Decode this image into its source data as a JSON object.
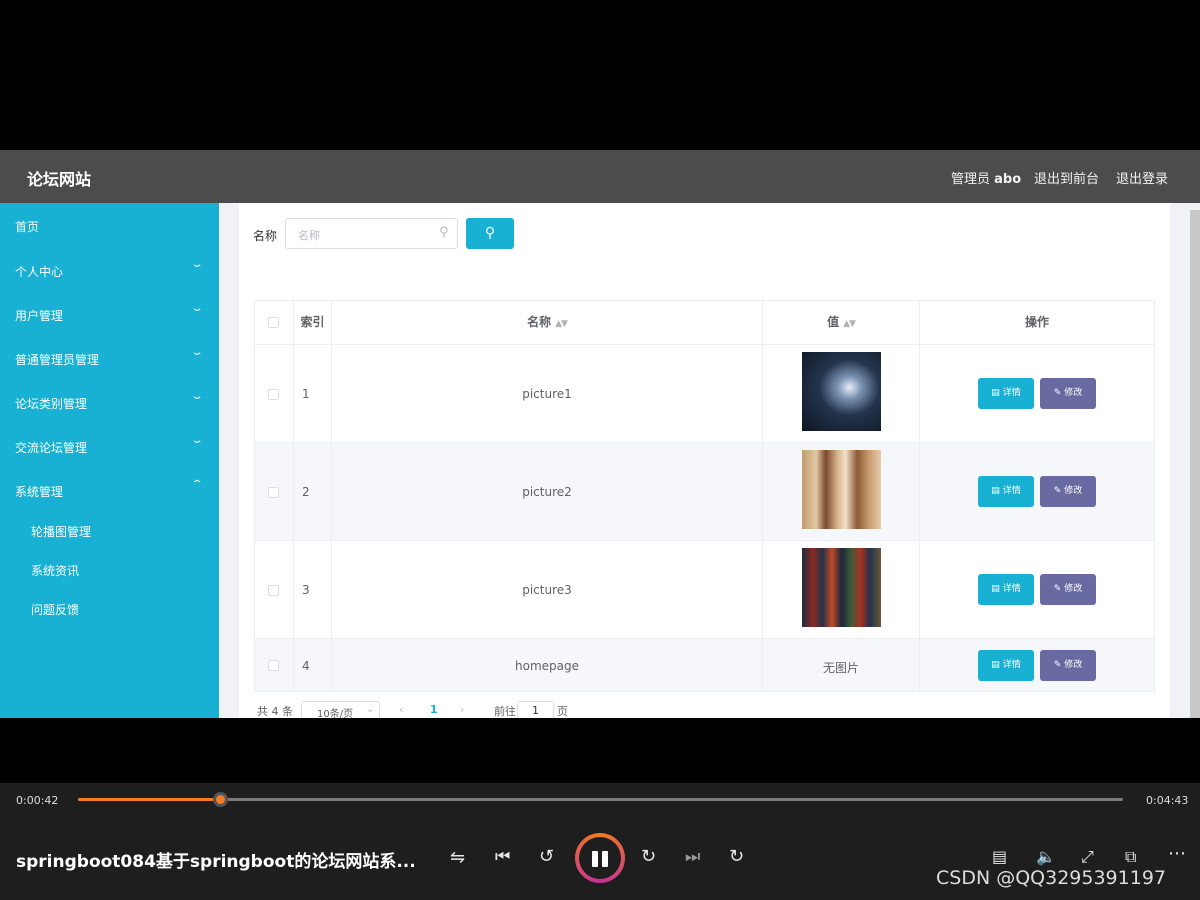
{
  "topbar": {
    "title": "论坛网站",
    "admin_prefix": "管理员",
    "admin_name": "abo",
    "back_front": "退出到前台",
    "logout": "退出登录"
  },
  "sidebar": {
    "items": [
      {
        "label": "首页",
        "chevron": ""
      },
      {
        "label": "个人中心",
        "chevron": "⌄"
      },
      {
        "label": "用户管理",
        "chevron": "⌄"
      },
      {
        "label": "普通管理员管理",
        "chevron": "⌄"
      },
      {
        "label": "论坛类别管理",
        "chevron": "⌄"
      },
      {
        "label": "交流论坛管理",
        "chevron": "⌄"
      },
      {
        "label": "系统管理",
        "chevron": "⌃"
      }
    ],
    "subitems": [
      {
        "label": "轮播图管理"
      },
      {
        "label": "系统资讯"
      },
      {
        "label": "问题反馈"
      }
    ]
  },
  "search": {
    "label": "名称",
    "placeholder": "名称",
    "search_icon": "search-icon"
  },
  "table": {
    "headers": {
      "index": "索引",
      "name": "名称",
      "value": "值",
      "actions": "操作"
    },
    "rows": [
      {
        "index": "1",
        "name": "picture1",
        "value": "",
        "has_image": true
      },
      {
        "index": "2",
        "name": "picture2",
        "value": "",
        "has_image": true
      },
      {
        "index": "3",
        "name": "picture3",
        "value": "",
        "has_image": true
      },
      {
        "index": "4",
        "name": "homepage",
        "value": "无图片",
        "has_image": false
      }
    ],
    "detail_label": "详情",
    "edit_label": "修改"
  },
  "pager": {
    "total": "共 4 条",
    "page_size": "10条/页",
    "current_page": "1",
    "goto_prefix": "前往",
    "goto_value": "1",
    "goto_suffix": "页"
  },
  "player": {
    "current_time": "0:00:42",
    "total_time": "0:04:43",
    "progress_fraction": 0.136,
    "title": "springboot084基于springboot的论坛网站系...",
    "watermark": "CSDN @QQ3295391197",
    "accent": "#f47c20"
  }
}
